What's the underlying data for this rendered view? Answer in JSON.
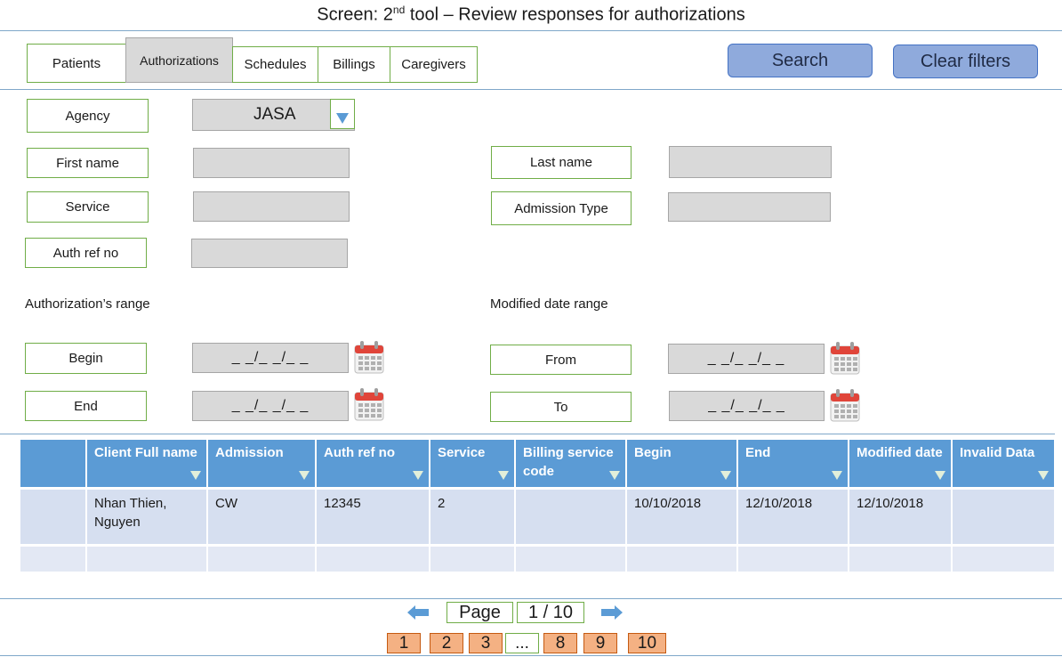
{
  "screen_title": {
    "prefix": "Screen: 2",
    "sup": "nd",
    "suffix": " tool – Review responses for authorizations"
  },
  "tabs": [
    "Patients",
    "Authorizations",
    "Schedules",
    "Billings",
    "Caregivers"
  ],
  "buttons": {
    "search": "Search",
    "clear": "Clear filters"
  },
  "filters": {
    "agency_label": "Agency",
    "agency_value": "JASA",
    "first_name_label": "First name",
    "last_name_label": "Last name",
    "service_label": "Service",
    "admission_type_label": "Admission Type",
    "auth_ref_label": "Auth ref no",
    "auth_range_label": "Authorization’s range",
    "modified_range_label": "Modified date range",
    "begin_label": "Begin",
    "end_label": "End",
    "from_label": "From",
    "to_label": "To",
    "date_mask": "_ _/_ _/_ _"
  },
  "table": {
    "headers": [
      "",
      "Client Full name",
      "Admission",
      "Auth ref no",
      "Service",
      "Billing service code",
      "Begin",
      "End",
      "Modified date",
      "Invalid Data"
    ],
    "rows": [
      [
        "",
        "Nhan Thien, Nguyen",
        "CW",
        "12345",
        "2",
        "",
        "10/10/2018",
        "12/10/2018",
        "12/10/2018",
        ""
      ],
      [
        "",
        "",
        "",
        "",
        "",
        "",
        "",
        "",
        "",
        ""
      ]
    ]
  },
  "pagination": {
    "page_label": "Page",
    "page_value": "1 / 10",
    "pages": [
      "1",
      "2",
      "3",
      "...",
      "8",
      "9",
      "10"
    ]
  },
  "colors": {
    "tab_border": "#70ad47",
    "button_fill": "#8faadc",
    "header_fill": "#5b9bd5",
    "page_number_fill": "#f4b183",
    "arrow": "#5b9bd5"
  }
}
